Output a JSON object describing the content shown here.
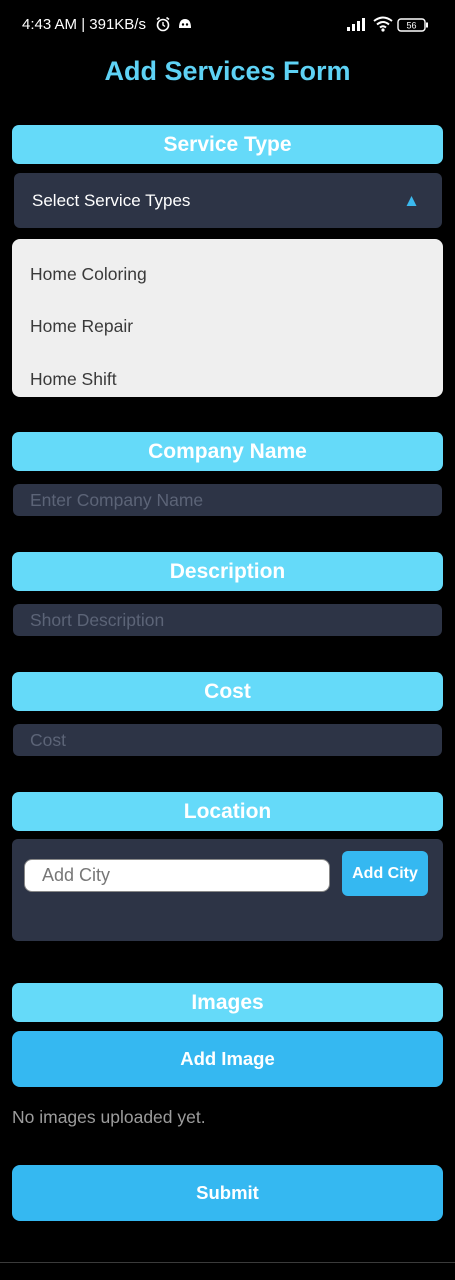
{
  "status_bar": {
    "time": "4:43 AM | 391KB/s",
    "battery": "56",
    "icons": [
      "alarm-icon",
      "notification-icon",
      "signal-icon",
      "wifi-icon",
      "battery-icon"
    ]
  },
  "form": {
    "title": "Add Services Form",
    "service_type": {
      "header": "Service Type",
      "select_label": "Select Service Types",
      "arrow": "▲",
      "options": [
        "Home Coloring",
        "Home Repair",
        "Home Shift"
      ]
    },
    "company_name": {
      "header": "Company Name",
      "placeholder": "Enter Company Name"
    },
    "description": {
      "header": "Description",
      "placeholder": "Short Description"
    },
    "cost": {
      "header": "Cost",
      "placeholder": "Cost"
    },
    "location": {
      "header": "Location",
      "city_placeholder": "Add City",
      "add_city_label": "Add City"
    },
    "images": {
      "header": "Images",
      "add_image_label": "Add Image",
      "empty_text": "No images uploaded yet."
    },
    "submit_label": "Submit"
  },
  "colors": {
    "background": "#000000",
    "title": "#5ed2f5",
    "section_header": "#65daf9",
    "button": "#35b8f1",
    "field": "#2d3446",
    "dropdown": "#efefef"
  }
}
